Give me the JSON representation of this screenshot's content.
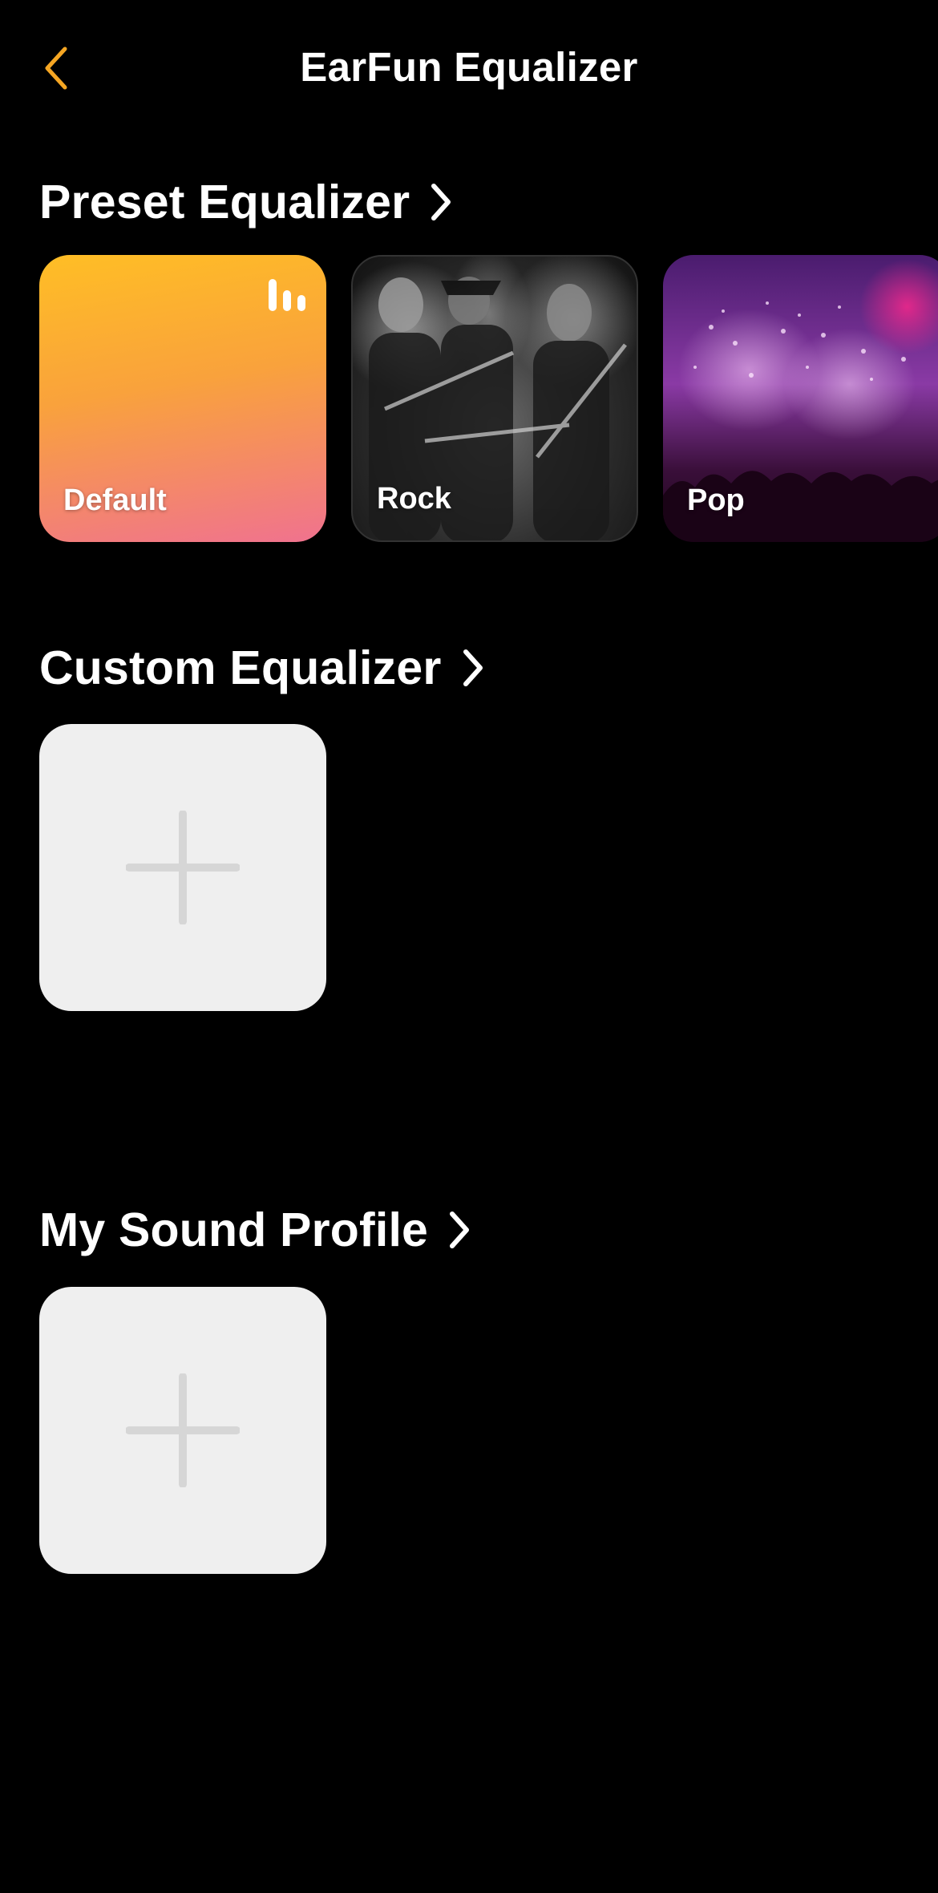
{
  "header": {
    "title": "EarFun Equalizer",
    "back_icon": "chevron-left-icon",
    "accent_color": "#f5a623"
  },
  "preset_section": {
    "title": "Preset Equalizer",
    "presets": [
      {
        "label": "Default",
        "selected": true,
        "selected_icon": "equalizer-bars-icon"
      },
      {
        "label": "Rock",
        "selected": false
      },
      {
        "label": "Pop",
        "selected": false
      }
    ]
  },
  "custom_section": {
    "title": "Custom Equalizer",
    "add_icon": "plus-icon"
  },
  "sound_profile_section": {
    "title": "My Sound Profile",
    "add_icon": "plus-icon"
  }
}
